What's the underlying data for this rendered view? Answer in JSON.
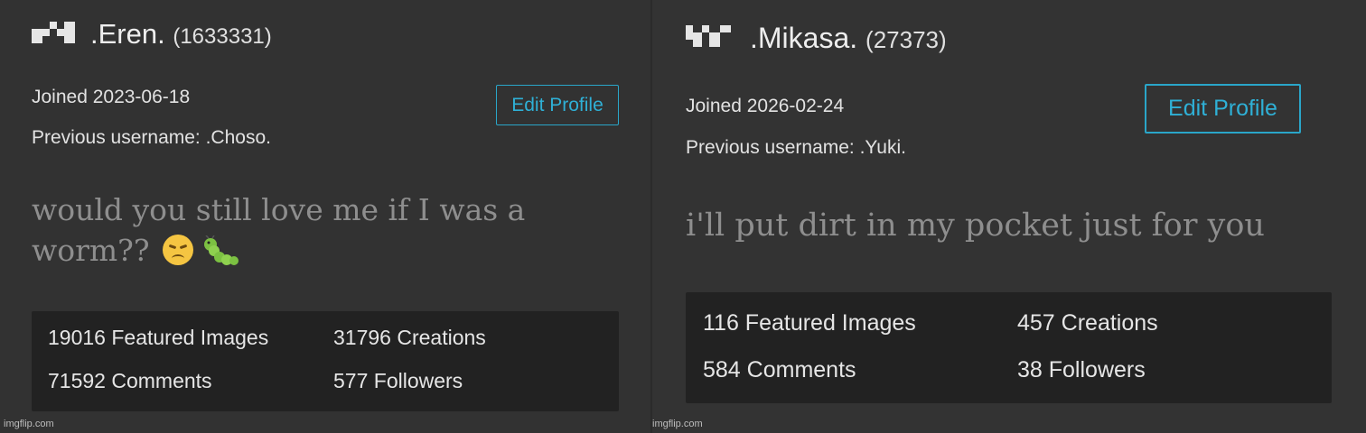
{
  "left": {
    "username": ".Eren.",
    "user_id": "(1633331)",
    "joined": "Joined 2023-06-18",
    "previous_username": "Previous username: .Choso.",
    "edit_button": "Edit Profile",
    "bio_line1": "would you still love me if I was a",
    "bio_line2": "worm??",
    "bio_emojis": [
      "disappointed-face-icon",
      "caterpillar-icon"
    ],
    "stats": {
      "featured": "19016 Featured Images",
      "creations": "31796 Creations",
      "comments": "71592 Comments",
      "followers": "577 Followers"
    },
    "watermark": "imgflip.com"
  },
  "right": {
    "username": ".Mikasa.",
    "user_id": "(27373)",
    "joined": "Joined 2026-02-24",
    "previous_username": "Previous username: .Yuki.",
    "edit_button": "Edit Profile",
    "bio": "i'll put dirt in my pocket just for you",
    "stats": {
      "featured": "116 Featured Images",
      "creations": "457 Creations",
      "comments": "584 Comments",
      "followers": "38 Followers"
    },
    "watermark": "imgflip.com"
  },
  "colors": {
    "accent": "#2fb0d6",
    "panel_bg": "#323232",
    "stats_bg": "#222222",
    "bio_text": "#8e8e8e"
  }
}
